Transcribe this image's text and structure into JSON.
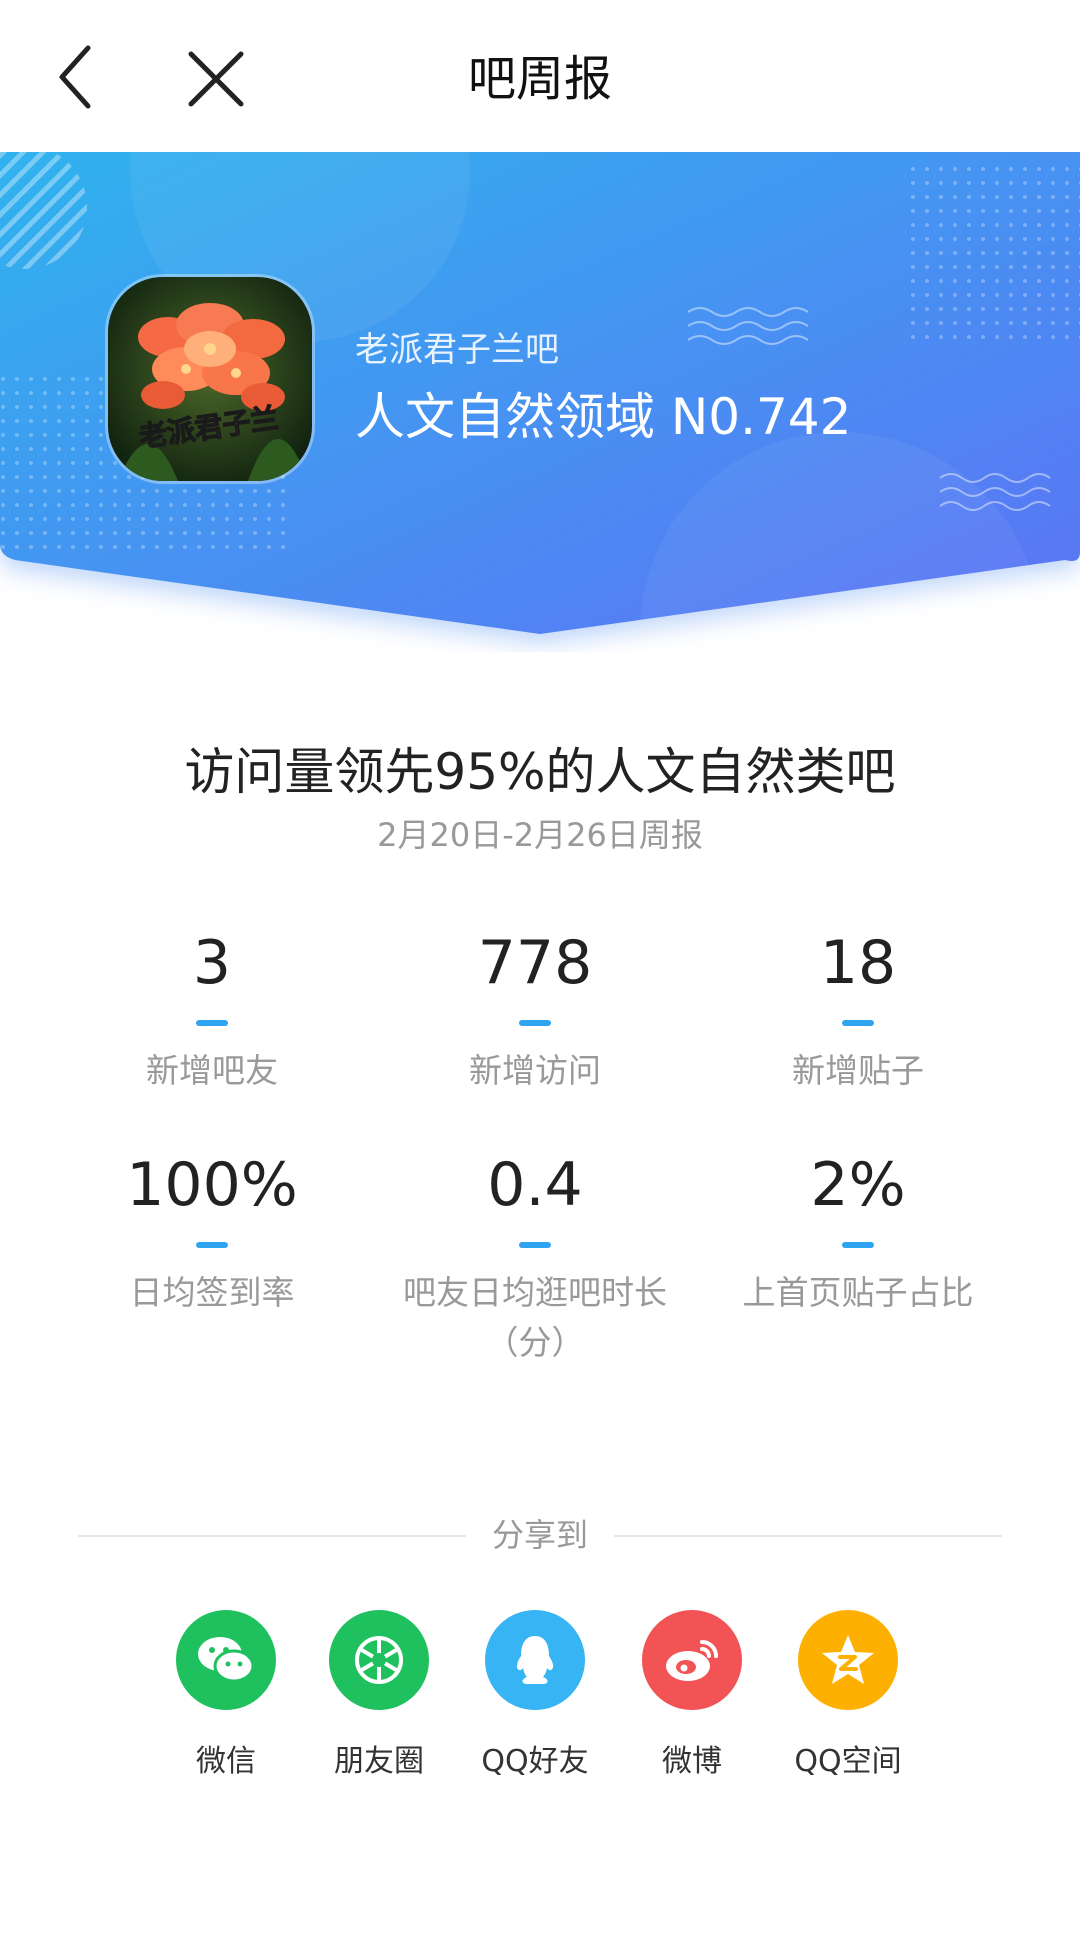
{
  "nav": {
    "title": "吧周报"
  },
  "banner": {
    "bar_name": "老派君子兰吧",
    "rank_text": "人文自然领域 N0.742",
    "avatar_caption": "老派君子兰"
  },
  "report": {
    "headline": "访问量领先95%的人文自然类吧",
    "period": "2月20日-2月26日周报"
  },
  "stats": [
    {
      "value": "3",
      "label": "新增吧友"
    },
    {
      "value": "778",
      "label": "新增访问"
    },
    {
      "value": "18",
      "label": "新增贴子"
    },
    {
      "value": "100%",
      "label": "日均签到率"
    },
    {
      "value": "0.4",
      "label": "吧友日均逛吧时长",
      "label2": "（分）"
    },
    {
      "value": "2%",
      "label": "上首页贴子占比"
    }
  ],
  "share": {
    "title": "分享到",
    "items": [
      {
        "label": "微信",
        "icon": "wechat-icon",
        "color": "#1fc15f"
      },
      {
        "label": "朋友圈",
        "icon": "moments-icon",
        "color": "#1fc15f"
      },
      {
        "label": "QQ好友",
        "icon": "qq-icon",
        "color": "#36b4f3"
      },
      {
        "label": "微博",
        "icon": "weibo-icon",
        "color": "#f25354"
      },
      {
        "label": "QQ空间",
        "icon": "qzone-icon",
        "color": "#fdb000"
      }
    ]
  },
  "colors": {
    "banner_start": "#2fb3ee",
    "banner_end": "#5d72f5",
    "accent_underline": "#2fa4f0"
  }
}
